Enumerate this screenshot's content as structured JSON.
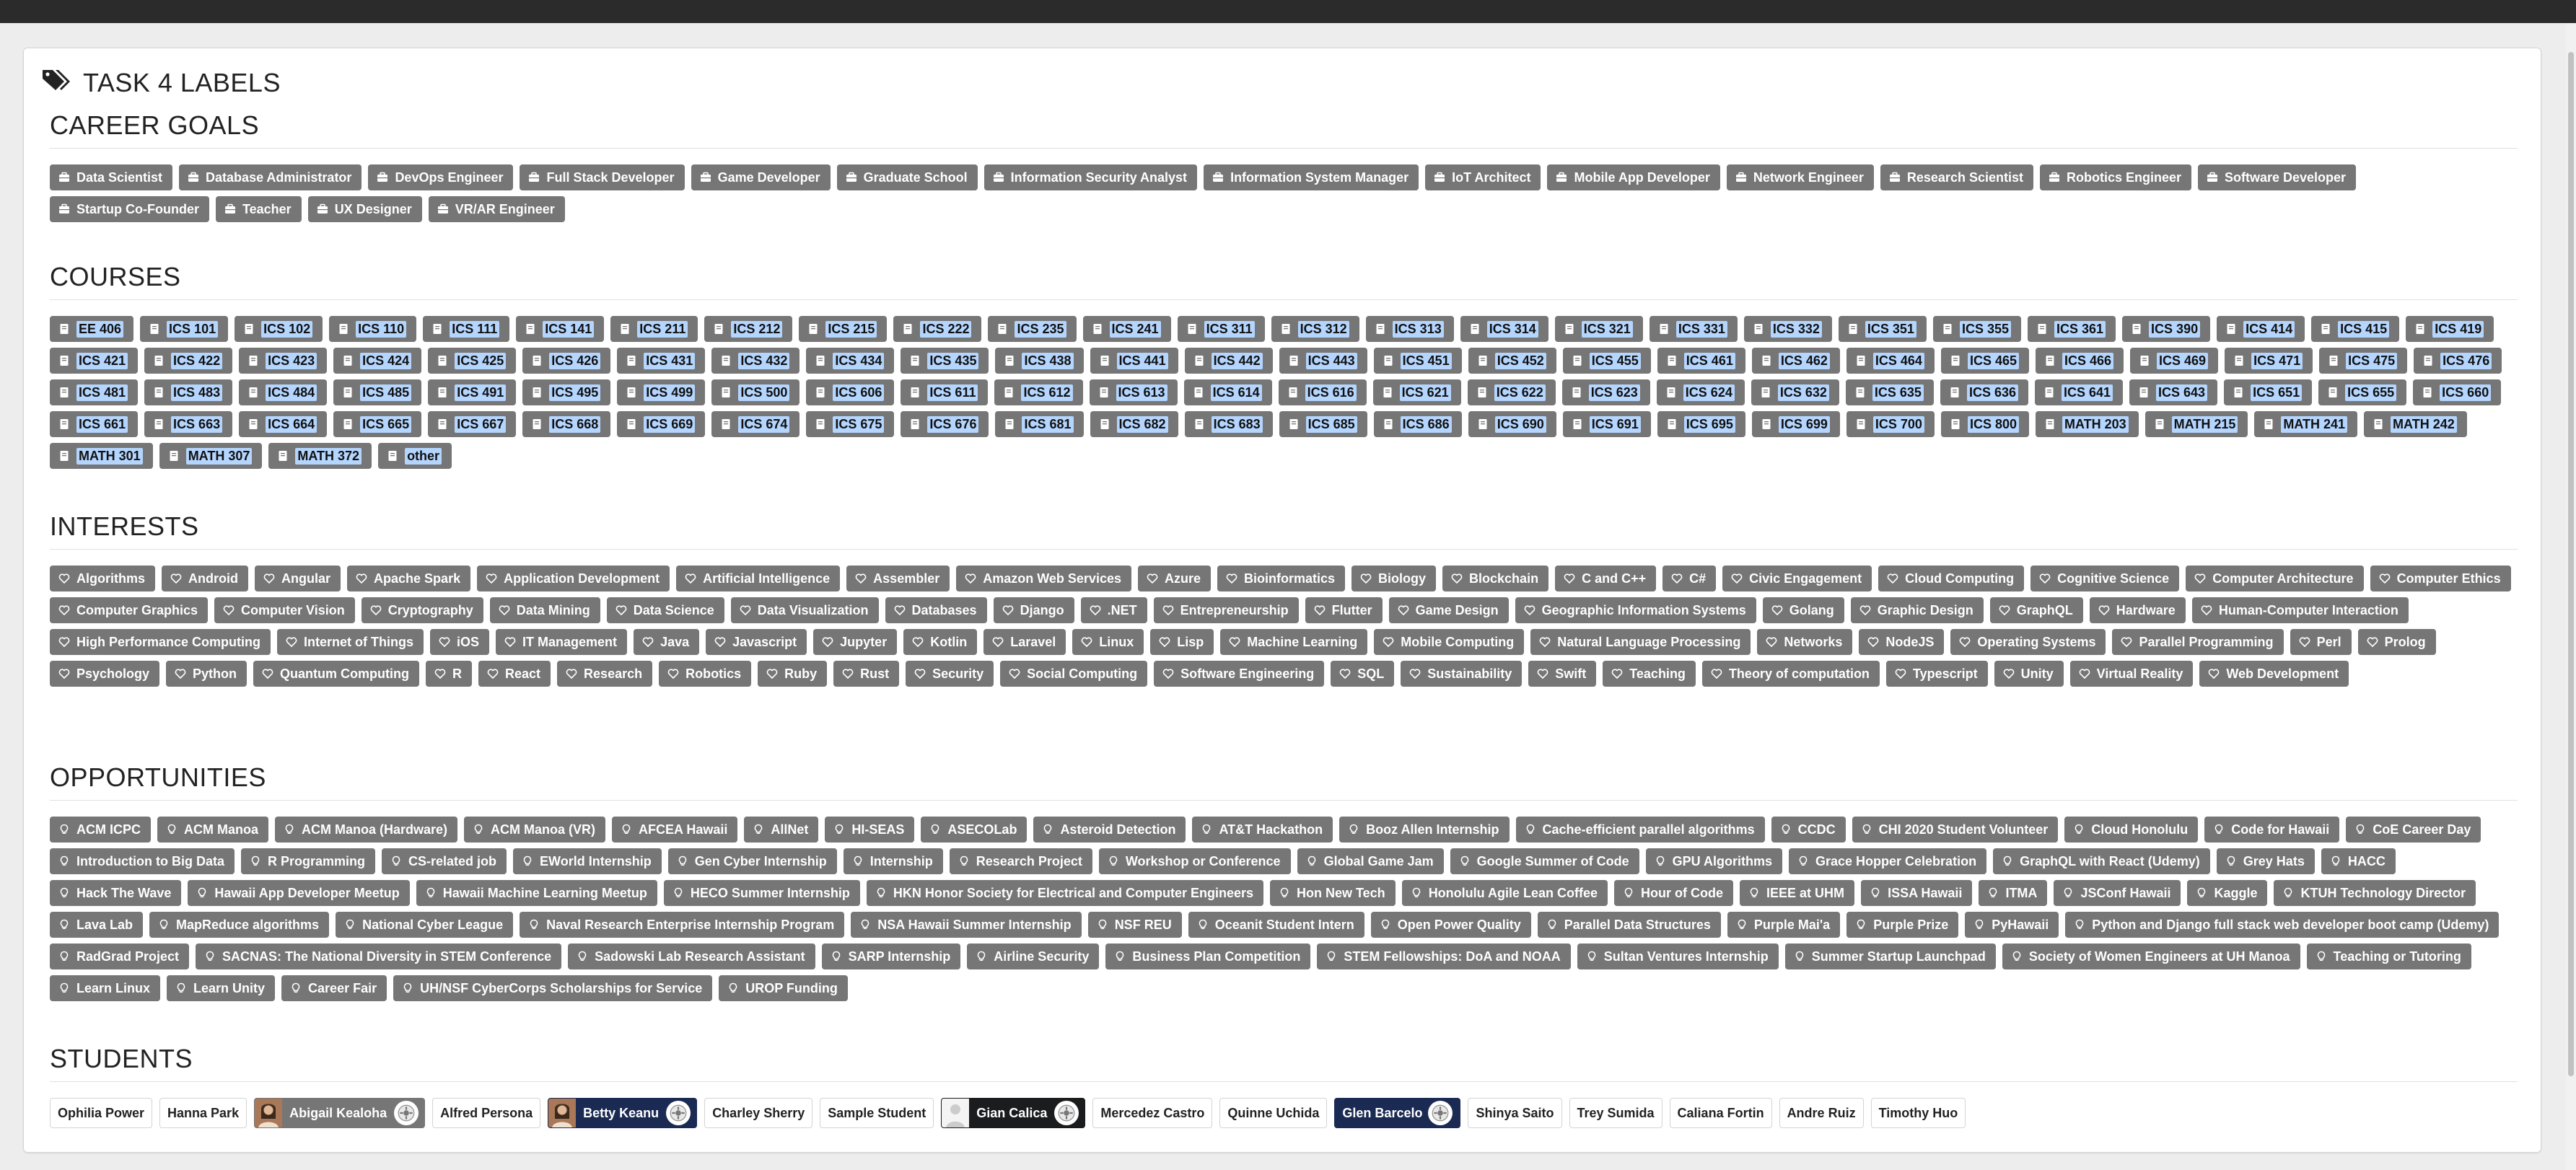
{
  "page": {
    "title": "TASK 4 LABELS"
  },
  "icons": {
    "header": "tags-icon",
    "career": "briefcase-icon",
    "course": "book-icon",
    "interest": "heart-icon",
    "opportunity": "lightbulb-icon",
    "badge": "gear-badge-icon"
  },
  "colors": {
    "label_bg": "#767676",
    "label_text": "#ffffff",
    "selection": "#b4d5fe",
    "navy": "#1b2a52"
  },
  "career_goals": {
    "title": "CAREER GOALS",
    "items": [
      "Data Scientist",
      "Database Administrator",
      "DevOps Engineer",
      "Full Stack Developer",
      "Game Developer",
      "Graduate School",
      "Information Security Analyst",
      "Information System Manager",
      "IoT Architect",
      "Mobile App Developer",
      "Network Engineer",
      "Research Scientist",
      "Robotics Engineer",
      "Software Developer",
      "Startup Co-Founder",
      "Teacher",
      "UX Designer",
      "VR/AR Engineer"
    ]
  },
  "courses": {
    "title": "COURSES",
    "items": [
      "EE 406",
      "ICS 101",
      "ICS 102",
      "ICS 110",
      "ICS 111",
      "ICS 141",
      "ICS 211",
      "ICS 212",
      "ICS 215",
      "ICS 222",
      "ICS 235",
      "ICS 241",
      "ICS 311",
      "ICS 312",
      "ICS 313",
      "ICS 314",
      "ICS 321",
      "ICS 331",
      "ICS 332",
      "ICS 351",
      "ICS 355",
      "ICS 361",
      "ICS 390",
      "ICS 414",
      "ICS 415",
      "ICS 419",
      "ICS 421",
      "ICS 422",
      "ICS 423",
      "ICS 424",
      "ICS 425",
      "ICS 426",
      "ICS 431",
      "ICS 432",
      "ICS 434",
      "ICS 435",
      "ICS 438",
      "ICS 441",
      "ICS 442",
      "ICS 443",
      "ICS 451",
      "ICS 452",
      "ICS 455",
      "ICS 461",
      "ICS 462",
      "ICS 464",
      "ICS 465",
      "ICS 466",
      "ICS 469",
      "ICS 471",
      "ICS 475",
      "ICS 476",
      "ICS 481",
      "ICS 483",
      "ICS 484",
      "ICS 485",
      "ICS 491",
      "ICS 495",
      "ICS 499",
      "ICS 500",
      "ICS 606",
      "ICS 611",
      "ICS 612",
      "ICS 613",
      "ICS 614",
      "ICS 616",
      "ICS 621",
      "ICS 622",
      "ICS 623",
      "ICS 624",
      "ICS 632",
      "ICS 635",
      "ICS 636",
      "ICS 641",
      "ICS 643",
      "ICS 651",
      "ICS 655",
      "ICS 660",
      "ICS 661",
      "ICS 663",
      "ICS 664",
      "ICS 665",
      "ICS 667",
      "ICS 668",
      "ICS 669",
      "ICS 674",
      "ICS 675",
      "ICS 676",
      "ICS 681",
      "ICS 682",
      "ICS 683",
      "ICS 685",
      "ICS 686",
      "ICS 690",
      "ICS 691",
      "ICS 695",
      "ICS 699",
      "ICS 700",
      "ICS 800",
      "MATH 203",
      "MATH 215",
      "MATH 241",
      "MATH 242",
      "MATH 301",
      "MATH 307",
      "MATH 372",
      "other"
    ]
  },
  "interests": {
    "title": "INTERESTS",
    "items": [
      "Algorithms",
      "Android",
      "Angular",
      "Apache Spark",
      "Application Development",
      "Artificial Intelligence",
      "Assembler",
      "Amazon Web Services",
      "Azure",
      "Bioinformatics",
      "Biology",
      "Blockchain",
      "C and C++",
      "C#",
      "Civic Engagement",
      "Cloud Computing",
      "Cognitive Science",
      "Computer Architecture",
      "Computer Ethics",
      "Computer Graphics",
      "Computer Vision",
      "Cryptography",
      "Data Mining",
      "Data Science",
      "Data Visualization",
      "Databases",
      "Django",
      ".NET",
      "Entrepreneurship",
      "Flutter",
      "Game Design",
      "Geographic Information Systems",
      "Golang",
      "Graphic Design",
      "GraphQL",
      "Hardware",
      "Human-Computer Interaction",
      "High Performance Computing",
      "Internet of Things",
      "iOS",
      "IT Management",
      "Java",
      "Javascript",
      "Jupyter",
      "Kotlin",
      "Laravel",
      "Linux",
      "Lisp",
      "Machine Learning",
      "Mobile Computing",
      "Natural Language Processing",
      "Networks",
      "NodeJS",
      "Operating Systems",
      "Parallel Programming",
      "Perl",
      "Prolog",
      "Psychology",
      "Python",
      "Quantum Computing",
      "R",
      "React",
      "Research",
      "Robotics",
      "Ruby",
      "Rust",
      "Security",
      "Social Computing",
      "Software Engineering",
      "SQL",
      "Sustainability",
      "Swift",
      "Teaching",
      "Theory of computation",
      "Typescript",
      "Unity",
      "Virtual Reality",
      "Web Development"
    ]
  },
  "opportunities": {
    "title": "OPPORTUNITIES",
    "items": [
      "ACM ICPC",
      "ACM Manoa",
      "ACM Manoa (Hardware)",
      "ACM Manoa (VR)",
      "AFCEA Hawaii",
      "AllNet",
      "HI-SEAS",
      "ASECOLab",
      "Asteroid Detection",
      "AT&T Hackathon",
      "Booz Allen Internship",
      "Cache-efficient parallel algorithms",
      "CCDC",
      "CHI 2020 Student Volunteer",
      "Cloud Honolulu",
      "Code for Hawaii",
      "CoE Career Day",
      "Introduction to Big Data",
      "R Programming",
      "CS-related job",
      "EWorld Internship",
      "Gen Cyber Internship",
      "Internship",
      "Research Project",
      "Workshop or Conference",
      "Global Game Jam",
      "Google Summer of Code",
      "GPU Algorithms",
      "Grace Hopper Celebration",
      "GraphQL with React (Udemy)",
      "Grey Hats",
      "HACC",
      "Hack The Wave",
      "Hawaii App Developer Meetup",
      "Hawaii Machine Learning Meetup",
      "HECO Summer Internship",
      "HKN Honor Society for Electrical and Computer Engineers",
      "Hon New Tech",
      "Honolulu Agile Lean Coffee",
      "Hour of Code",
      "IEEE at UHM",
      "ISSA Hawaii",
      "ITMA",
      "JSConf Hawaii",
      "Kaggle",
      "KTUH Technology Director",
      "Lava Lab",
      "MapReduce algorithms",
      "National Cyber League",
      "Naval Research Enterprise Internship Program",
      "NSA Hawaii Summer Internship",
      "NSF REU",
      "Oceanit Student Intern",
      "Open Power Quality",
      "Parallel Data Structures",
      "Purple Mai'a",
      "Purple Prize",
      "PyHawaii",
      "Python and Django full stack web developer boot camp (Udemy)",
      "RadGrad Project",
      "SACNAS: The National Diversity in STEM Conference",
      "Sadowski Lab Research Assistant",
      "SARP Internship",
      "Airline Security",
      "Business Plan Competition",
      "STEM Fellowships: DoA and NOAA",
      "Sultan Ventures Internship",
      "Summer Startup Launchpad",
      "Society of Women Engineers at UH Manoa",
      "Teaching or Tutoring",
      "Learn Linux",
      "Learn Unity",
      "Career Fair",
      "UH/NSF CyberCorps Scholarships for Service",
      "UROP Funding"
    ]
  },
  "students": {
    "title": "STUDENTS",
    "items": [
      {
        "name": "Ophilia Power",
        "style": "plain"
      },
      {
        "name": "Hanna Park",
        "style": "plain"
      },
      {
        "name": "Abigail Kealoha",
        "style": "gray",
        "avatar": "photo",
        "badge": true
      },
      {
        "name": "Alfred Persona",
        "style": "plain"
      },
      {
        "name": "Betty Keanu",
        "style": "navy",
        "avatar": "photo",
        "badge": true
      },
      {
        "name": "Charley Sherry",
        "style": "plain"
      },
      {
        "name": "Sample Student",
        "style": "plain"
      },
      {
        "name": "Gian Calica",
        "style": "dark",
        "avatar": "default",
        "badge": true
      },
      {
        "name": "Mercedez Castro",
        "style": "plain"
      },
      {
        "name": "Quinne Uchida",
        "style": "plain"
      },
      {
        "name": "Glen Barcelo",
        "style": "navy",
        "avatar": "none",
        "badge": true
      },
      {
        "name": "Shinya Saito",
        "style": "plain"
      },
      {
        "name": "Trey Sumida",
        "style": "plain"
      },
      {
        "name": "Caliana Fortin",
        "style": "plain"
      },
      {
        "name": "Andre Ruiz",
        "style": "plain"
      },
      {
        "name": "Timothy Huo",
        "style": "plain"
      }
    ]
  }
}
